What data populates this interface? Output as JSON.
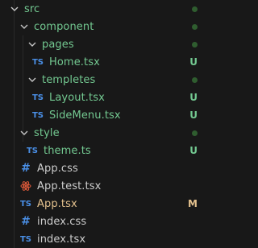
{
  "colors": {
    "folder_green": "#73c991",
    "untracked": "#73c991",
    "modified": "#e2c08d",
    "normal": "#cccccc",
    "ts_icon": "#4a8fe6",
    "css_icon": "#4a8fe6",
    "test_icon": "#e05a3a",
    "badge_dot": "#2f5d2f"
  },
  "explorer": {
    "items": [
      {
        "label": "src",
        "kind": "folder",
        "badge": "dot"
      },
      {
        "label": "component",
        "kind": "folder",
        "badge": "dot"
      },
      {
        "label": "pages",
        "kind": "folder",
        "badge": "dot"
      },
      {
        "label": "Home.tsx",
        "kind": "file",
        "icon": "typescript-icon",
        "icon_text": "TS",
        "badge": "U"
      },
      {
        "label": "templetes",
        "kind": "folder",
        "badge": "dot"
      },
      {
        "label": "Layout.tsx",
        "kind": "file",
        "icon": "typescript-icon",
        "icon_text": "TS",
        "badge": "U"
      },
      {
        "label": "SideMenu.tsx",
        "kind": "file",
        "icon": "typescript-icon",
        "icon_text": "TS",
        "badge": "U"
      },
      {
        "label": "style",
        "kind": "folder",
        "badge": "dot"
      },
      {
        "label": "theme.ts",
        "kind": "file",
        "icon": "typescript-icon",
        "icon_text": "TS",
        "badge": "U"
      },
      {
        "label": "App.css",
        "kind": "file",
        "icon": "css-hash-icon",
        "icon_text": "#",
        "badge": ""
      },
      {
        "label": "App.test.tsx",
        "kind": "file",
        "icon": "test-react-icon",
        "icon_text": "",
        "badge": ""
      },
      {
        "label": "App.tsx",
        "kind": "file",
        "icon": "typescript-icon",
        "icon_text": "TS",
        "badge": "M"
      },
      {
        "label": "index.css",
        "kind": "file",
        "icon": "css-hash-icon",
        "icon_text": "#",
        "badge": ""
      },
      {
        "label": "index.tsx",
        "kind": "file",
        "icon": "typescript-icon",
        "icon_text": "TS",
        "badge": ""
      }
    ]
  }
}
